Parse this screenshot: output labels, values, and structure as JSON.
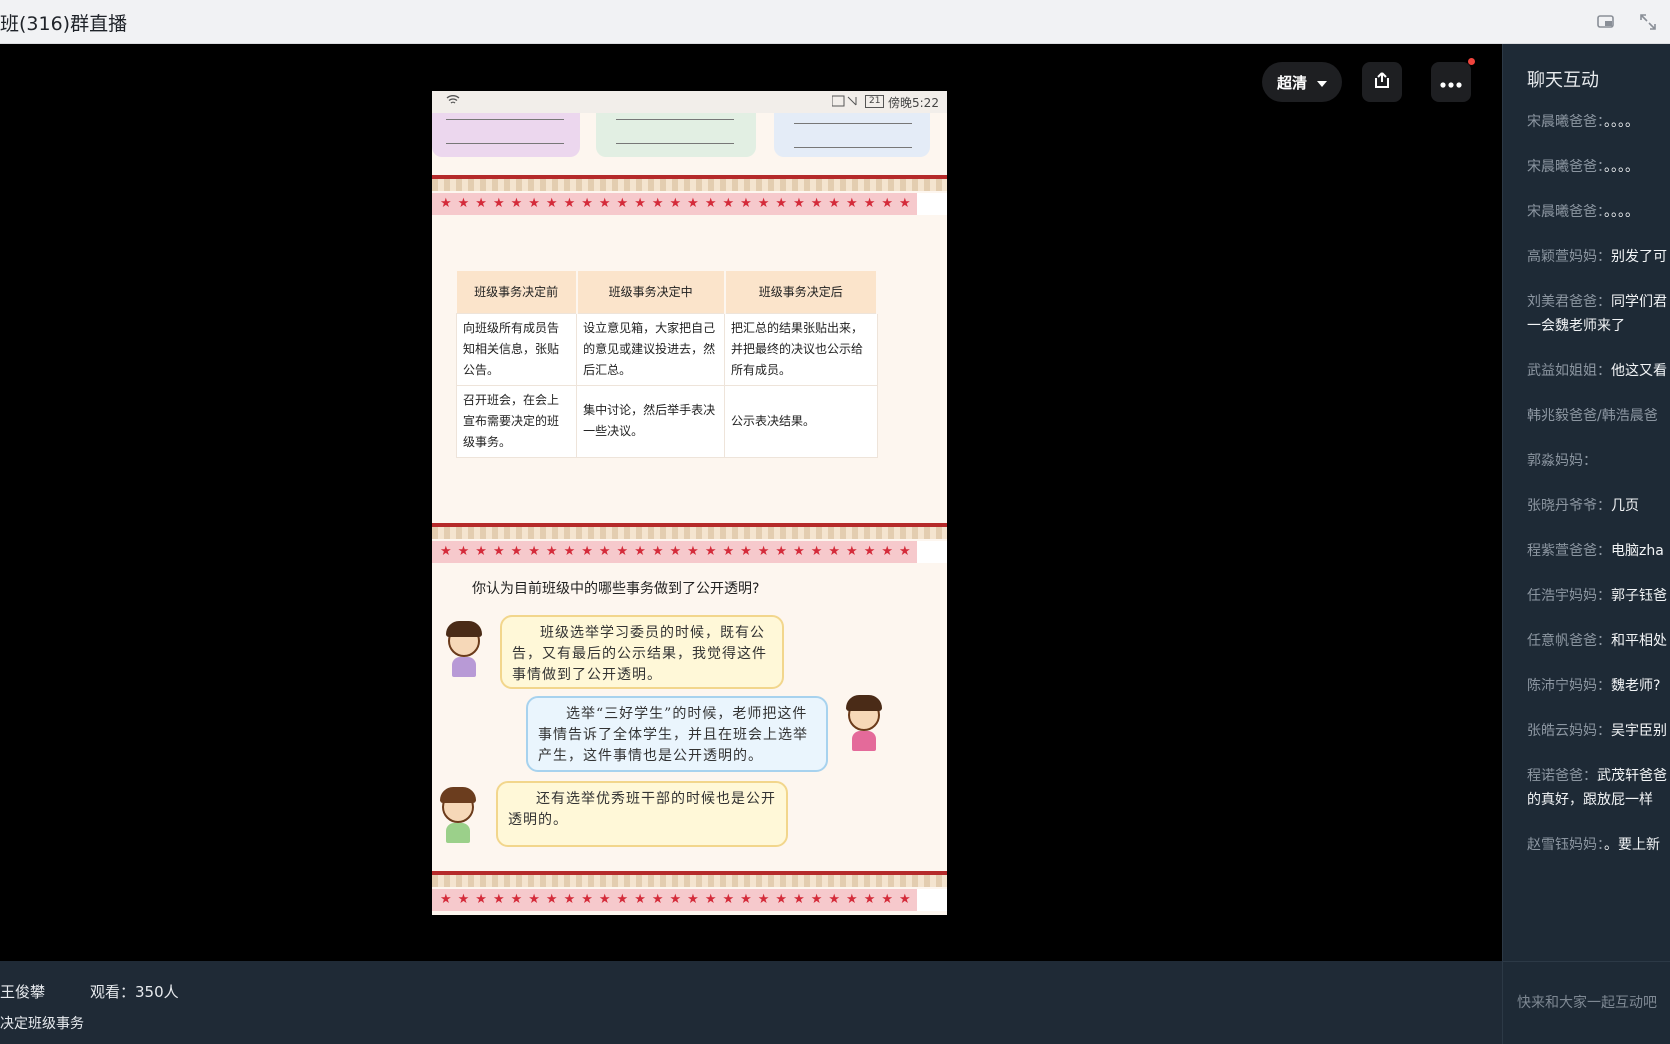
{
  "window": {
    "title": "班(316)群直播"
  },
  "controls": {
    "quality_label": "超清"
  },
  "slide": {
    "status_time": "傍晚5:22",
    "battery": "21",
    "table": {
      "headers": [
        "班级事务决定前",
        "班级事务决定中",
        "班级事务决定后"
      ],
      "rows": [
        [
          "向班级所有成员告知相关信息，张贴公告。",
          "设立意见箱，大家把自己的意见或建议投进去，然后汇总。",
          "把汇总的结果张贴出来，并把最终的决议也公示给所有成员。"
        ],
        [
          "召开班会，在会上宣布需要决定的班级事务。",
          "集中讨论，然后举手表决一些决议。",
          "公示表决结果。"
        ]
      ]
    },
    "question": "你认为目前班级中的哪些事务做到了公开透明?",
    "bubbles": [
      "班级选举学习委员的时候，既有公告，又有最后的公示结果，我觉得这件事情做到了公开透明。",
      "选举“三好学生”的时候，老师把这件事情告诉了全体学生，并且在班会上选举产生，这件事情也是公开透明的。",
      "还有选举优秀班干部的时候也是公开透明的。"
    ],
    "stars": "★★★★★★★★★★★★★★★★★★★★★★★★★★★★★★★"
  },
  "info": {
    "host": "王俊攀",
    "viewers": "观看：350人",
    "topic": "决定班级事务"
  },
  "chat": {
    "title": "聊天互动",
    "messages": [
      {
        "name": "宋晨曦爸爸：",
        "text": "。。。。"
      },
      {
        "name": "宋晨曦爸爸：",
        "text": "。。。。"
      },
      {
        "name": "宋晨曦爸爸：",
        "text": "。。。。"
      },
      {
        "name": "高颖萱妈妈：",
        "text": "别发了可"
      },
      {
        "name": "刘美君爸爸：",
        "text": "同学们君"
      },
      {
        "name": "",
        "text": "一会魏老师来了"
      },
      {
        "name": "武益如姐姐：",
        "text": "他这又看"
      },
      {
        "name": "韩兆毅爸爸/韩浩晨爸",
        "text": ""
      },
      {
        "name": "郭淼妈妈：",
        "text": ""
      },
      {
        "name": "张晓丹爷爷：",
        "text": "几页"
      },
      {
        "name": "程紫萱爸爸：",
        "text": "电脑zha"
      },
      {
        "name": "任浩宇妈妈：",
        "text": "郭子钰爸"
      },
      {
        "name": "任意帆爸爸：",
        "text": "和平相处"
      },
      {
        "name": "陈沛宁妈妈：",
        "text": "魏老师?"
      },
      {
        "name": "张皓云妈妈：",
        "text": "吴宇臣别"
      },
      {
        "name": "程诺爸爸：",
        "text": "武茂轩爸爸"
      },
      {
        "name": "",
        "text": "的真好，跟放屁一样"
      },
      {
        "name": "赵雪钰妈妈：",
        "text": "。要上新"
      }
    ],
    "input_placeholder": "快来和大家一起互动吧"
  }
}
